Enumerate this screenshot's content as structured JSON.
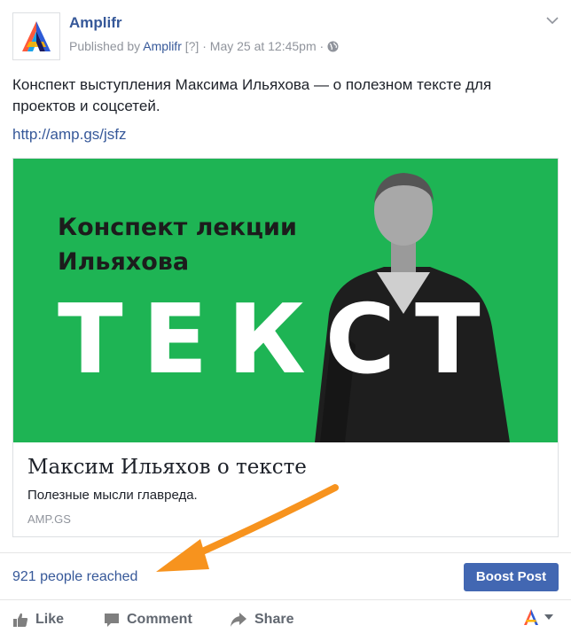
{
  "page": {
    "name": "Amplifr",
    "published_prefix": "Published by",
    "published_by": "Amplifr",
    "help_mark": "[?]",
    "separator": "·",
    "date": "May 25 at 12:45pm",
    "audience_icon": "globe-icon"
  },
  "post": {
    "text": "Конспект выступления Максима Ильяхова — о полезном тексте для проектов и соцсетей.",
    "link": "http://amp.gs/jsfz"
  },
  "card": {
    "image_headline_line1": "Конспект лекции",
    "image_headline_line2": "Ильяхова",
    "image_big_word": "ТЕКСТ",
    "image_background": "#1eb454",
    "title": "Максим Ильяхов о тексте",
    "description": "Полезные мысли главреда.",
    "domain": "AMP.GS"
  },
  "stats": {
    "reach": "921 people reached",
    "boost_label": "Boost Post"
  },
  "actions": {
    "like": "Like",
    "comment": "Comment",
    "share": "Share"
  },
  "colors": {
    "link": "#365899",
    "boost": "#4267b2",
    "annotation_arrow": "#f7931e"
  }
}
